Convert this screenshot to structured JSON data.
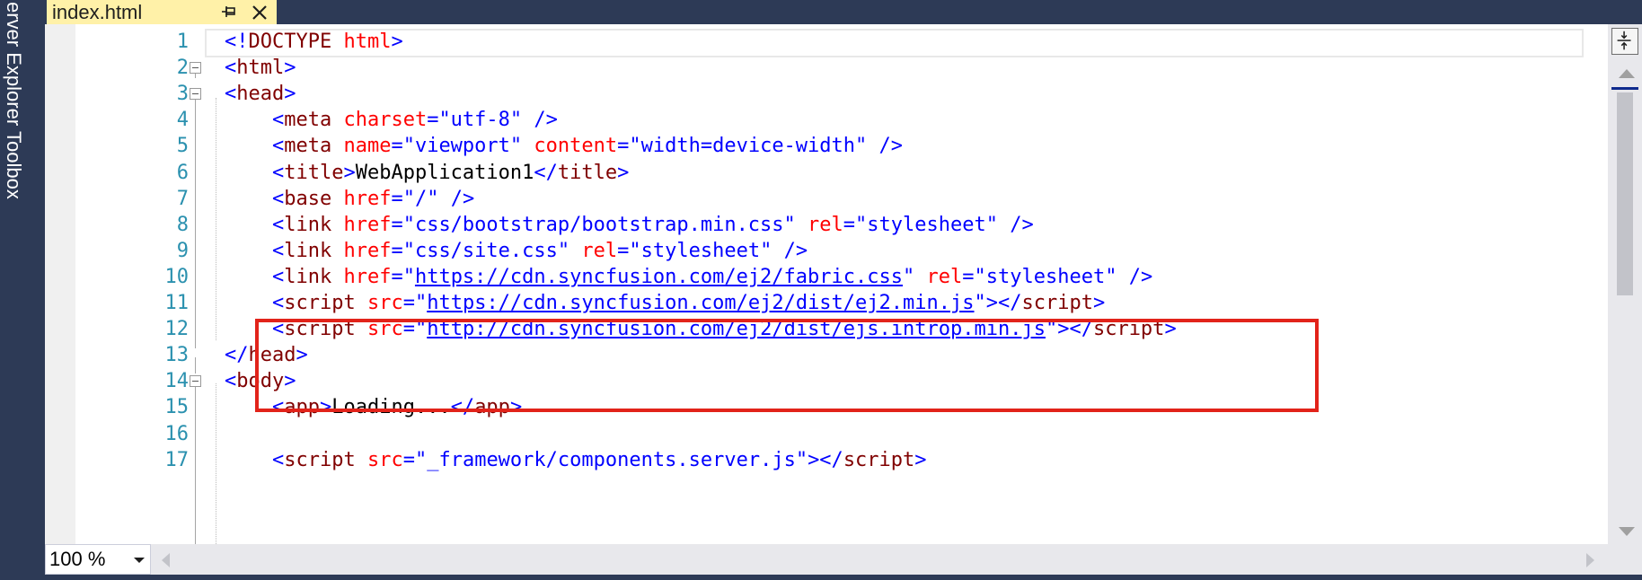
{
  "siderail": {
    "server_explorer": "erver Explorer",
    "toolbox": "Toolbox"
  },
  "tab": {
    "title": "index.html",
    "pin_icon": "pin-icon",
    "close_icon": "close-icon"
  },
  "colors": {
    "chrome": "#2d3a56",
    "active_tab": "#fff1a8",
    "tag": "#800000",
    "delimiter": "#0000ff",
    "attribute": "#ff0000",
    "line_number": "#2b91af",
    "highlight_box": "#e2231a"
  },
  "lines": [
    {
      "n": "1",
      "fold": false,
      "parts": [
        [
          "d",
          "<!"
        ],
        [
          "t",
          "DOCTYPE"
        ],
        [
          "x",
          " "
        ],
        [
          "a",
          "html"
        ],
        [
          "d",
          ">"
        ]
      ]
    },
    {
      "n": "2",
      "fold": true,
      "parts": [
        [
          "d",
          "<"
        ],
        [
          "t",
          "html"
        ],
        [
          "d",
          ">"
        ]
      ]
    },
    {
      "n": "3",
      "fold": true,
      "parts": [
        [
          "d",
          "<"
        ],
        [
          "t",
          "head"
        ],
        [
          "d",
          ">"
        ]
      ]
    },
    {
      "n": "4",
      "fold": false,
      "parts": [
        [
          "x",
          "    "
        ],
        [
          "d",
          "<"
        ],
        [
          "t",
          "meta"
        ],
        [
          "x",
          " "
        ],
        [
          "a",
          "charset"
        ],
        [
          "d",
          "="
        ],
        [
          "v",
          "\"utf-8\""
        ],
        [
          "x",
          " "
        ],
        [
          "d",
          "/>"
        ]
      ]
    },
    {
      "n": "5",
      "fold": false,
      "parts": [
        [
          "x",
          "    "
        ],
        [
          "d",
          "<"
        ],
        [
          "t",
          "meta"
        ],
        [
          "x",
          " "
        ],
        [
          "a",
          "name"
        ],
        [
          "d",
          "="
        ],
        [
          "v",
          "\"viewport\""
        ],
        [
          "x",
          " "
        ],
        [
          "a",
          "content"
        ],
        [
          "d",
          "="
        ],
        [
          "v",
          "\"width=device-width\""
        ],
        [
          "x",
          " "
        ],
        [
          "d",
          "/>"
        ]
      ]
    },
    {
      "n": "6",
      "fold": false,
      "parts": [
        [
          "x",
          "    "
        ],
        [
          "d",
          "<"
        ],
        [
          "t",
          "title"
        ],
        [
          "d",
          ">"
        ],
        [
          "x",
          "WebApplication1"
        ],
        [
          "d",
          "</"
        ],
        [
          "t",
          "title"
        ],
        [
          "d",
          ">"
        ]
      ]
    },
    {
      "n": "7",
      "fold": false,
      "parts": [
        [
          "x",
          "    "
        ],
        [
          "d",
          "<"
        ],
        [
          "t",
          "base"
        ],
        [
          "x",
          " "
        ],
        [
          "a",
          "href"
        ],
        [
          "d",
          "="
        ],
        [
          "v",
          "\"/\""
        ],
        [
          "x",
          " "
        ],
        [
          "d",
          "/>"
        ]
      ]
    },
    {
      "n": "8",
      "fold": false,
      "parts": [
        [
          "x",
          "    "
        ],
        [
          "d",
          "<"
        ],
        [
          "t",
          "link"
        ],
        [
          "x",
          " "
        ],
        [
          "a",
          "href"
        ],
        [
          "d",
          "="
        ],
        [
          "v",
          "\"css/bootstrap/bootstrap.min.css\""
        ],
        [
          "x",
          " "
        ],
        [
          "a",
          "rel"
        ],
        [
          "d",
          "="
        ],
        [
          "v",
          "\"stylesheet\""
        ],
        [
          "x",
          " "
        ],
        [
          "d",
          "/>"
        ]
      ]
    },
    {
      "n": "9",
      "fold": false,
      "parts": [
        [
          "x",
          "    "
        ],
        [
          "d",
          "<"
        ],
        [
          "t",
          "link"
        ],
        [
          "x",
          " "
        ],
        [
          "a",
          "href"
        ],
        [
          "d",
          "="
        ],
        [
          "v",
          "\"css/site.css\""
        ],
        [
          "x",
          " "
        ],
        [
          "a",
          "rel"
        ],
        [
          "d",
          "="
        ],
        [
          "v",
          "\"stylesheet\""
        ],
        [
          "x",
          " "
        ],
        [
          "d",
          "/>"
        ]
      ]
    },
    {
      "n": "10",
      "fold": false,
      "parts": [
        [
          "x",
          "    "
        ],
        [
          "d",
          "<"
        ],
        [
          "t",
          "link"
        ],
        [
          "x",
          " "
        ],
        [
          "a",
          "href"
        ],
        [
          "d",
          "=\""
        ],
        [
          "u",
          "https://cdn.syncfusion.com/ej2/fabric.css"
        ],
        [
          "d",
          "\""
        ],
        [
          "x",
          " "
        ],
        [
          "a",
          "rel"
        ],
        [
          "d",
          "="
        ],
        [
          "v",
          "\"stylesheet\""
        ],
        [
          "x",
          " "
        ],
        [
          "d",
          "/>"
        ]
      ]
    },
    {
      "n": "11",
      "fold": false,
      "parts": [
        [
          "x",
          "    "
        ],
        [
          "d",
          "<"
        ],
        [
          "t",
          "script"
        ],
        [
          "x",
          " "
        ],
        [
          "a",
          "src"
        ],
        [
          "d",
          "=\""
        ],
        [
          "u",
          "https://cdn.syncfusion.com/ej2/dist/ej2.min.js"
        ],
        [
          "d",
          "\"></"
        ],
        [
          "t",
          "script"
        ],
        [
          "d",
          ">"
        ]
      ]
    },
    {
      "n": "12",
      "fold": false,
      "parts": [
        [
          "x",
          "    "
        ],
        [
          "d",
          "<"
        ],
        [
          "t",
          "script"
        ],
        [
          "x",
          " "
        ],
        [
          "a",
          "src"
        ],
        [
          "d",
          "=\""
        ],
        [
          "u",
          "http://cdn.syncfusion.com/ej2/dist/ejs.introp.min.js"
        ],
        [
          "d",
          "\"></"
        ],
        [
          "t",
          "script"
        ],
        [
          "d",
          ">"
        ]
      ]
    },
    {
      "n": "13",
      "fold": false,
      "parts": [
        [
          "d",
          "</"
        ],
        [
          "t",
          "head"
        ],
        [
          "d",
          ">"
        ]
      ]
    },
    {
      "n": "14",
      "fold": true,
      "parts": [
        [
          "d",
          "<"
        ],
        [
          "t",
          "body"
        ],
        [
          "d",
          ">"
        ]
      ]
    },
    {
      "n": "15",
      "fold": false,
      "parts": [
        [
          "x",
          "    "
        ],
        [
          "d",
          "<"
        ],
        [
          "t",
          "app"
        ],
        [
          "d",
          ">"
        ],
        [
          "x",
          "Loading..."
        ],
        [
          "d",
          "</"
        ],
        [
          "t",
          "app"
        ],
        [
          "d",
          ">"
        ]
      ]
    },
    {
      "n": "16",
      "fold": false,
      "parts": []
    },
    {
      "n": "17",
      "fold": false,
      "parts": [
        [
          "x",
          "    "
        ],
        [
          "d",
          "<"
        ],
        [
          "t",
          "script"
        ],
        [
          "x",
          " "
        ],
        [
          "a",
          "src"
        ],
        [
          "d",
          "="
        ],
        [
          "v",
          "\"_framework/components.server.js\""
        ],
        [
          "d",
          "></"
        ],
        [
          "t",
          "script"
        ],
        [
          "d",
          ">"
        ]
      ]
    }
  ],
  "zoom": {
    "value": "100 %"
  }
}
